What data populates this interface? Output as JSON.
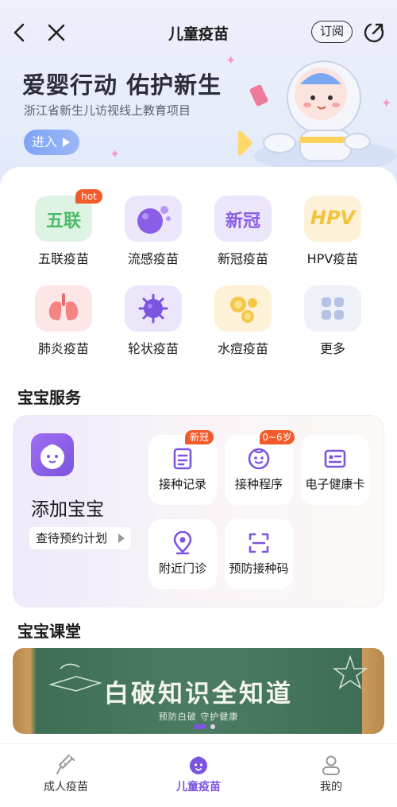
{
  "navbar": {
    "title": "儿童疫苗",
    "subscribe_label": "订阅"
  },
  "banner": {
    "title": "爱婴行动 佑护新生",
    "subtitle": "浙江省新生儿访视线上教育项目",
    "button_label": "进入"
  },
  "vaccine_grid": {
    "items": [
      {
        "label": "五联疫苗",
        "icon_text": "五联",
        "badge": "hot",
        "icon": "pentavalent-icon"
      },
      {
        "label": "流感疫苗",
        "icon": "flu-icon"
      },
      {
        "label": "新冠疫苗",
        "icon_text": "新冠",
        "icon": "covid-icon"
      },
      {
        "label": "HPV疫苗",
        "icon_text": "HPV",
        "icon": "hpv-icon"
      },
      {
        "label": "肺炎疫苗",
        "icon": "lungs-icon"
      },
      {
        "label": "轮状疫苗",
        "icon": "rotavirus-icon"
      },
      {
        "label": "水痘疫苗",
        "icon": "varicella-icon"
      },
      {
        "label": "更多",
        "icon": "more-grid-icon"
      }
    ]
  },
  "baby_service": {
    "section_title": "宝宝服务",
    "add_baby_label": "添加宝宝",
    "plan_label": "查待预约计划",
    "buttons": [
      {
        "label": "接种记录",
        "badge": "新冠",
        "icon": "record-icon"
      },
      {
        "label": "接种程序",
        "badge": "0~6岁",
        "icon": "schedule-icon"
      },
      {
        "label": "电子健康卡",
        "icon": "health-card-icon"
      },
      {
        "label": "附近门诊",
        "icon": "location-pin-icon"
      },
      {
        "label": "预防接种码",
        "icon": "scan-code-icon"
      }
    ]
  },
  "classroom": {
    "section_title": "宝宝课堂",
    "banner_title": "白破知识全知道",
    "banner_subtitle": "预防白破 守护健康"
  },
  "tabbar": {
    "tabs": [
      {
        "label": "成人疫苗",
        "icon": "syringe-icon",
        "active": false
      },
      {
        "label": "儿童疫苗",
        "icon": "baby-face-icon",
        "active": true
      },
      {
        "label": "我的",
        "icon": "user-icon",
        "active": false
      }
    ]
  },
  "colors": {
    "accent": "#7b54e0",
    "badge": "#f25a2a"
  }
}
